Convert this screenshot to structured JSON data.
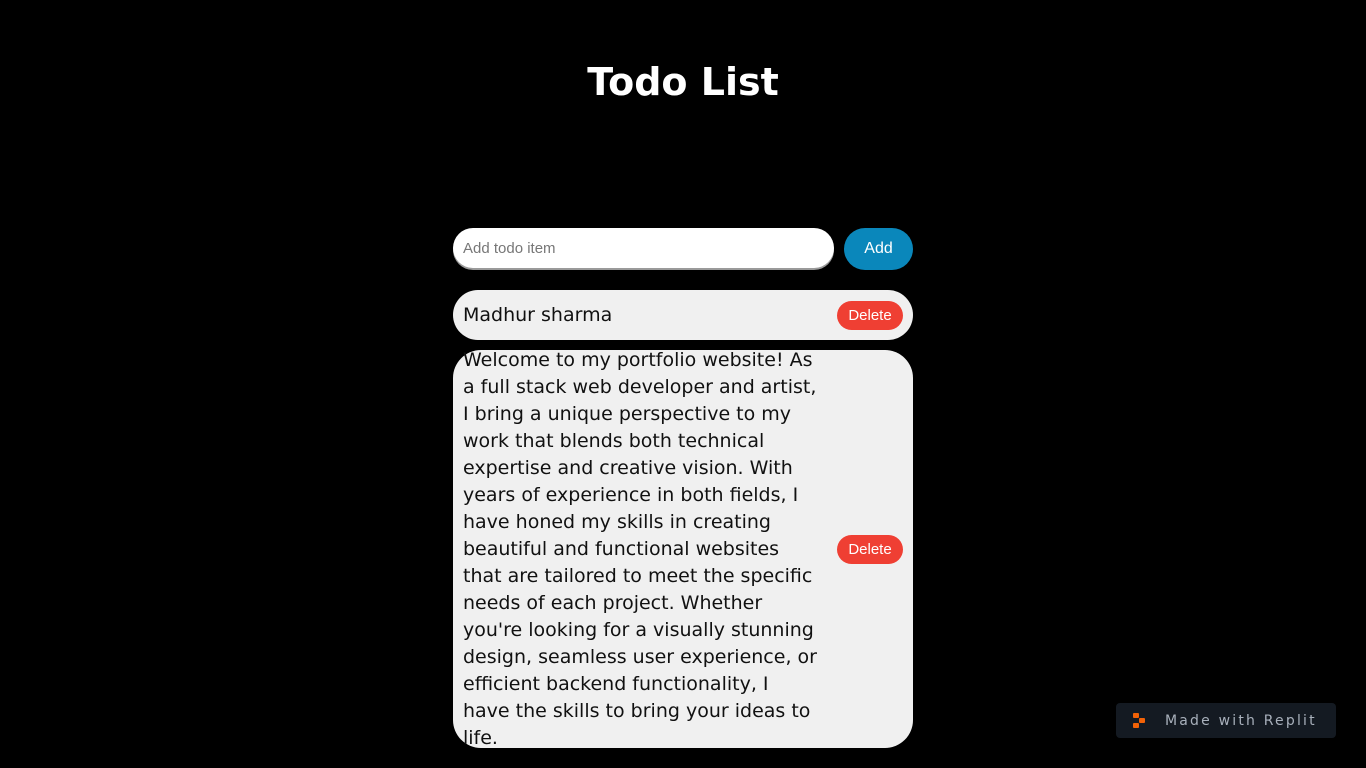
{
  "header": {
    "title": "Todo List"
  },
  "add_form": {
    "placeholder": "Add todo item",
    "value": "",
    "add_label": "Add"
  },
  "todos": [
    {
      "text": "Madhur sharma",
      "delete_label": "Delete"
    },
    {
      "text": "Welcome to my portfolio website! As a full stack web developer and artist, I bring a unique perspective to my work that blends both technical expertise and creative vision. With years of experience in both fields, I have honed my skills in creating beautiful and functional websites that are tailored to meet the specific needs of each project. Whether you're looking for a visually stunning design, seamless user experience, or efficient backend functionality, I have the skills to bring your ideas to life.",
      "delete_label": "Delete"
    }
  ],
  "badge": {
    "label": "Made with Replit",
    "icon": "replit-logo-icon"
  },
  "colors": {
    "background": "#000000",
    "add_button": "#0a87bb",
    "delete_button": "#ef3f33",
    "item_background": "#f0f0f0",
    "replit_orange": "#f26207"
  }
}
